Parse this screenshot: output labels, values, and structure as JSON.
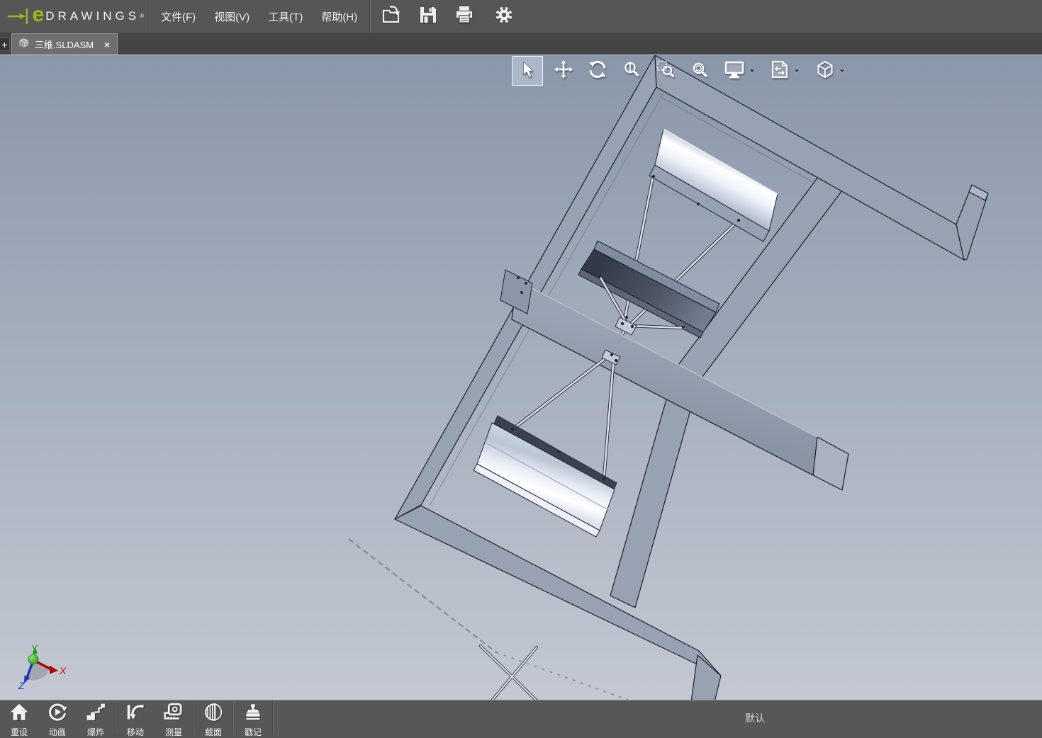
{
  "brand": {
    "e": "e",
    "name": "DRAWINGS",
    "registered": "®",
    "accent_color": "#9cba16"
  },
  "menubar": {
    "items": [
      {
        "label": "文件(F)"
      },
      {
        "label": "视图(V)"
      },
      {
        "label": "工具(T)"
      },
      {
        "label": "帮助(H)"
      }
    ]
  },
  "quick_actions": [
    {
      "icon": "open-icon"
    },
    {
      "icon": "save-icon"
    },
    {
      "icon": "print-icon"
    },
    {
      "icon": "settings-icon"
    }
  ],
  "tabbar": {
    "new_tab": "+",
    "tabs": [
      {
        "title": "三维.SLDASM",
        "close": "×",
        "active": true,
        "icon": "assembly-icon"
      }
    ]
  },
  "view_toolbar": {
    "active": "select",
    "buttons": [
      {
        "icon": "select-arrow-icon",
        "active": true
      },
      {
        "icon": "pan-icon"
      },
      {
        "icon": "rotate-icon"
      },
      {
        "icon": "zoom-icon"
      },
      {
        "icon": "zoom-area-icon"
      },
      {
        "icon": "zoom-fit-icon"
      },
      {
        "icon": "fullscreen-icon",
        "dropdown": true
      },
      {
        "icon": "drawing-sheet-icon",
        "dropdown": true
      },
      {
        "icon": "view-orientation-icon",
        "dropdown": true
      }
    ]
  },
  "viewport": {
    "background_top": "#8a97aa",
    "background_bottom": "#c3c8d2",
    "model_file": "三维.SLDASM",
    "triad": {
      "x": "X",
      "y": "Y",
      "z": "Z",
      "x_color": "#cc1111",
      "y_color": "#18a018",
      "z_color": "#2233cc"
    }
  },
  "bottom_toolbar": {
    "buttons": [
      {
        "label": "重设",
        "icon": "home-icon"
      },
      {
        "label": "动画",
        "icon": "animation-icon"
      },
      {
        "label": "爆炸",
        "icon": "explode-icon"
      },
      {
        "label": "移动",
        "icon": "move-icon"
      },
      {
        "label": "测量",
        "icon": "measure-icon"
      },
      {
        "label": "截面",
        "icon": "section-icon"
      },
      {
        "label": "戳记",
        "icon": "stamp-icon"
      }
    ]
  },
  "statusbar": {
    "configuration": "默认"
  }
}
